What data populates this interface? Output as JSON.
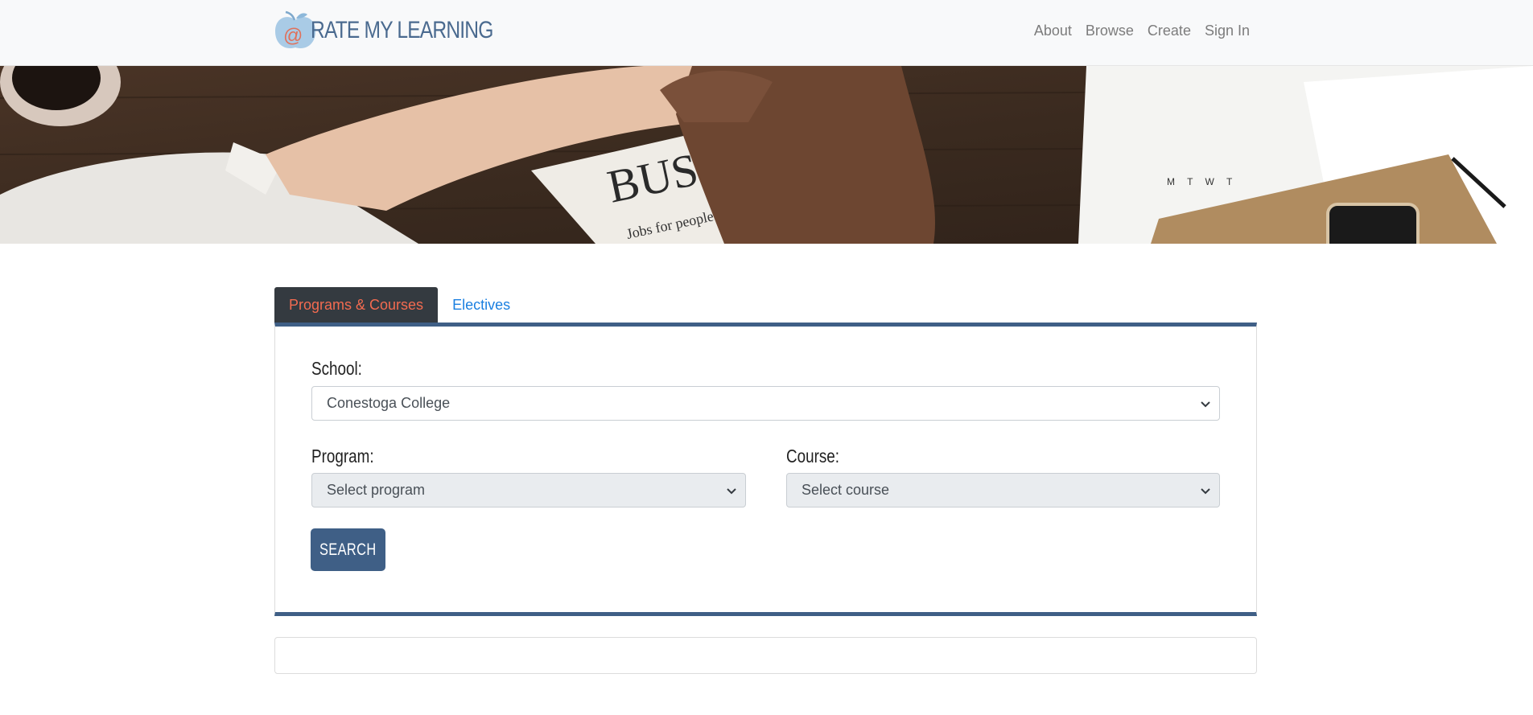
{
  "header": {
    "brand_at": "@",
    "brand_text": "RATE MY LEARNING",
    "nav": [
      "About",
      "Browse",
      "Create",
      "Sign In"
    ]
  },
  "tabs": [
    {
      "label": "Programs & Courses",
      "active": true
    },
    {
      "label": "Electives",
      "active": false
    }
  ],
  "form": {
    "school_label": "School:",
    "school_value": "Conestoga College",
    "program_label": "Program:",
    "program_value": "Select program",
    "course_label": "Course:",
    "course_value": "Select course",
    "search_label": "SEARCH"
  },
  "newspaper_text": "BUS",
  "newspaper_sub": "Jobs for people w",
  "calendar_text": "M T W T",
  "colors": {
    "accent": "#3f5f86",
    "active_tab_bg": "#343a40",
    "active_tab_text": "#f36b50",
    "link": "#1a7fe0"
  }
}
